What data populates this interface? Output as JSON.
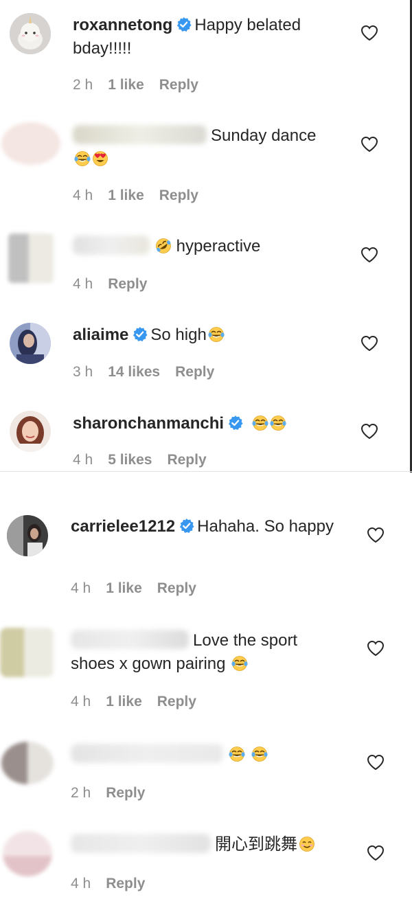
{
  "comments_top": [
    {
      "username": "roxannetong",
      "verified": true,
      "text": "Happy belated bday!!!!!",
      "emojis": [],
      "time": "2 h",
      "likes": "1 like",
      "reply": "Reply"
    },
    {
      "username": "",
      "verified": false,
      "text": "Sunday dance",
      "emojis": [
        "tears-of-joy",
        "heart-eyes"
      ],
      "time": "4 h",
      "likes": "1 like",
      "reply": "Reply"
    },
    {
      "username": "",
      "verified": false,
      "text": "hyperactive",
      "emojis_before": [
        "rolling-laughing"
      ],
      "time": "4 h",
      "likes": "",
      "reply": "Reply"
    },
    {
      "username": "aliaime",
      "verified": true,
      "text": "So high",
      "emojis": [
        "tears-of-joy"
      ],
      "time": "3 h",
      "likes": "14 likes",
      "reply": "Reply"
    },
    {
      "username": "sharonchanmanchi",
      "verified": true,
      "text": "",
      "emojis": [
        "tears-of-joy",
        "tears-of-joy"
      ],
      "time": "4 h",
      "likes": "5 likes",
      "reply": "Reply"
    }
  ],
  "comments_bottom": [
    {
      "username": "carrielee1212",
      "verified": true,
      "text": "Hahaha. So happy",
      "emojis": [],
      "time": "4 h",
      "likes": "1 like",
      "reply": "Reply"
    },
    {
      "username": "",
      "verified": false,
      "text": "Love the sport shoes x gown pairing",
      "emojis": [
        "tears-of-joy"
      ],
      "time": "4 h",
      "likes": "1 like",
      "reply": "Reply"
    },
    {
      "username": "",
      "verified": false,
      "text": "",
      "emojis": [
        "tears-of-joy",
        "tears-of-joy"
      ],
      "time": "2 h",
      "likes": "",
      "reply": "Reply"
    },
    {
      "username": "",
      "verified": false,
      "text": "開心到跳舞",
      "emojis": [
        "smiling-face"
      ],
      "time": "4 h",
      "likes": "",
      "reply": "Reply"
    }
  ],
  "colors": {
    "text": "#262626",
    "meta": "#8e8e8e",
    "verified": "#3897f0",
    "divider": "#e3e3e3"
  }
}
